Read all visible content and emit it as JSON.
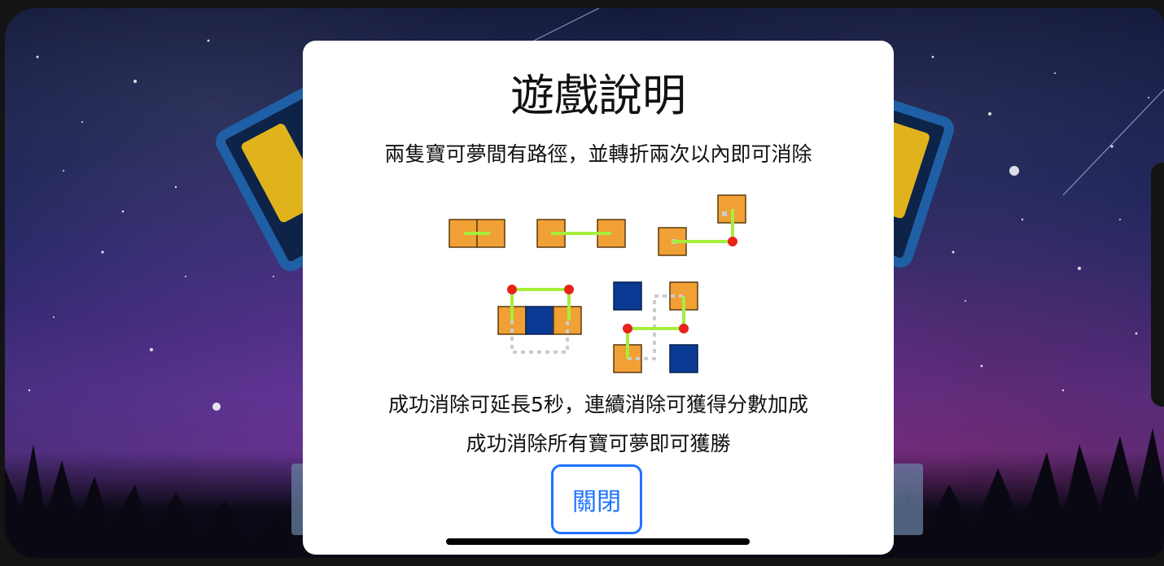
{
  "dialog": {
    "title": "遊戲說明",
    "rule_line": "兩隻寶可夢間有路徑，並轉折兩次以內即可消除",
    "bonus_line": "成功消除可延長5秒，連續消除可獲得分數加成",
    "win_line": "成功消除所有寶可夢即可獲勝",
    "close_label": "關閉"
  },
  "colors": {
    "tile_orange": "#f0a034",
    "tile_blue": "#0b3a94",
    "path_green": "#a7ee3c",
    "turn_dot_red": "#e8231a",
    "close_blue": "#1e73ff"
  },
  "icons": {
    "background": "starry-night-background",
    "decorations": [
      "shield-icon",
      "shield-icon"
    ]
  }
}
